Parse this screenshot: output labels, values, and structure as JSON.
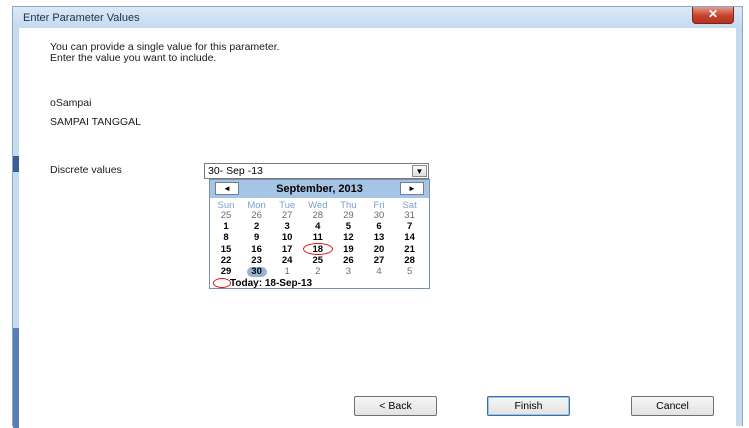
{
  "window": {
    "title": "Enter Parameter Values",
    "close_glyph": "✕"
  },
  "prompt": {
    "line1": "You can provide a single value for this parameter.",
    "line2": "Enter the value you want to include."
  },
  "parameter": {
    "name": "oSampai",
    "prompt_text": "SAMPAI TANGGAL"
  },
  "discrete": {
    "label": "Discrete values",
    "value": "30- Sep -13"
  },
  "calendar": {
    "month_label": "September, 2013",
    "prev_glyph": "◄",
    "next_glyph": "►",
    "dropdown_glyph": "▼",
    "weekdays": [
      "Sun",
      "Mon",
      "Tue",
      "Wed",
      "Thu",
      "Fri",
      "Sat"
    ],
    "weeks": [
      [
        "25",
        "26",
        "27",
        "28",
        "29",
        "30",
        "31"
      ],
      [
        "1",
        "2",
        "3",
        "4",
        "5",
        "6",
        "7"
      ],
      [
        "8",
        "9",
        "10",
        "11",
        "12",
        "13",
        "14"
      ],
      [
        "15",
        "16",
        "17",
        "18",
        "19",
        "20",
        "21"
      ],
      [
        "22",
        "23",
        "24",
        "25",
        "26",
        "27",
        "28"
      ],
      [
        "29",
        "30",
        "1",
        "2",
        "3",
        "4",
        "5"
      ]
    ],
    "selected_day": "30",
    "today_day": "18",
    "today_label": "Today: 18-Sep-13"
  },
  "buttons": {
    "back": "< Back",
    "finish": "Finish",
    "cancel": "Cancel"
  },
  "colors": {
    "header": "#a6c4e4",
    "weekday": "#7aa0cc",
    "selected": "#98b4d4",
    "today_ring": "#e01010"
  }
}
